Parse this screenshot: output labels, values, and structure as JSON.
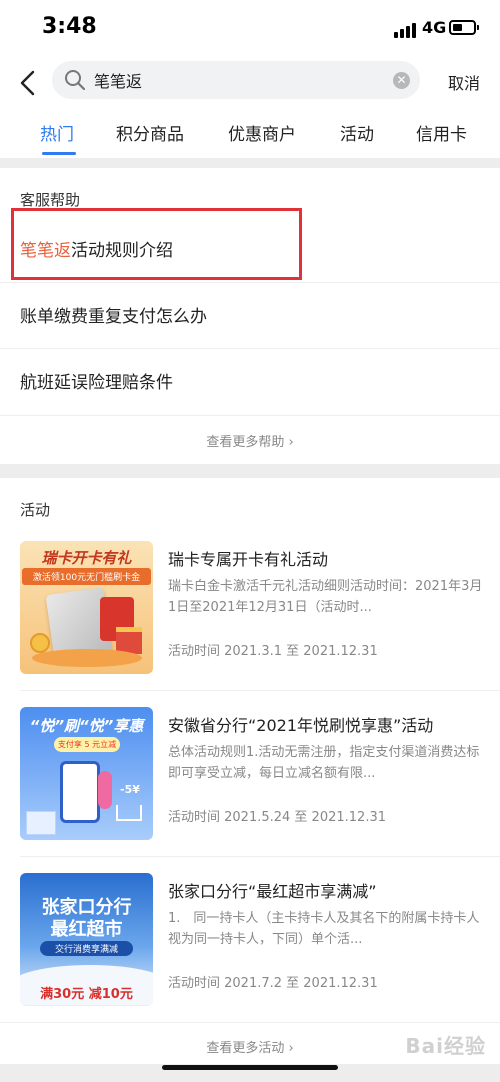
{
  "status": {
    "time": "3:48",
    "network": "4G"
  },
  "search": {
    "query": "笔笔返",
    "cancel": "取消"
  },
  "tabs": [
    "热门",
    "积分商品",
    "优惠商户",
    "活动",
    "信用卡"
  ],
  "help": {
    "title": "客服帮助",
    "items": [
      {
        "highlight": "笔笔返",
        "rest": "活动规则介绍"
      },
      {
        "highlight": "",
        "rest": "账单缴费重复支付怎么办"
      },
      {
        "highlight": "",
        "rest": "航班延误险理赔条件"
      }
    ],
    "more": "查看更多帮助 ›"
  },
  "activities": {
    "title": "活动",
    "items": [
      {
        "title": "瑞卡专属开卡有礼活动",
        "desc": "瑞卡白金卡激活千元礼活动细则活动时间：2021年3月1日至2021年12月31日（活动时...",
        "time": "活动时间 2021.3.1 至 2021.12.31",
        "thumb": {
          "line1": "瑞卡开卡有礼",
          "line2": "激活领100元无门槛刷卡金",
          "icon": "bank-card-icon"
        }
      },
      {
        "title": "安徽省分行“2021年悦刷悦享惠”活动",
        "desc": "总体活动规则1.活动无需注册，指定支付渠道消费达标即可享受立减，每日立减名额有限...",
        "time": "活动时间 2021.5.24 至 2021.12.31",
        "thumb": {
          "line1": "“悦”刷“悦”享惠",
          "line2": "支付享 5 元立减",
          "badge": "-5¥"
        }
      },
      {
        "title": "张家口分行“最红超市享满减”",
        "desc": "1.　同一持卡人（主卡持卡人及其名下的附属卡持卡人视为同一持卡人，下同）单个活...",
        "time": "活动时间 2021.7.2 至 2021.12.31",
        "thumb": {
          "line1": "张家口分行",
          "line2": "最红超市",
          "line3": "交行消费享满减",
          "line4": "满30元 减10元"
        }
      }
    ],
    "more": "查看更多活动 ›"
  },
  "watermark": "Bai经验"
}
